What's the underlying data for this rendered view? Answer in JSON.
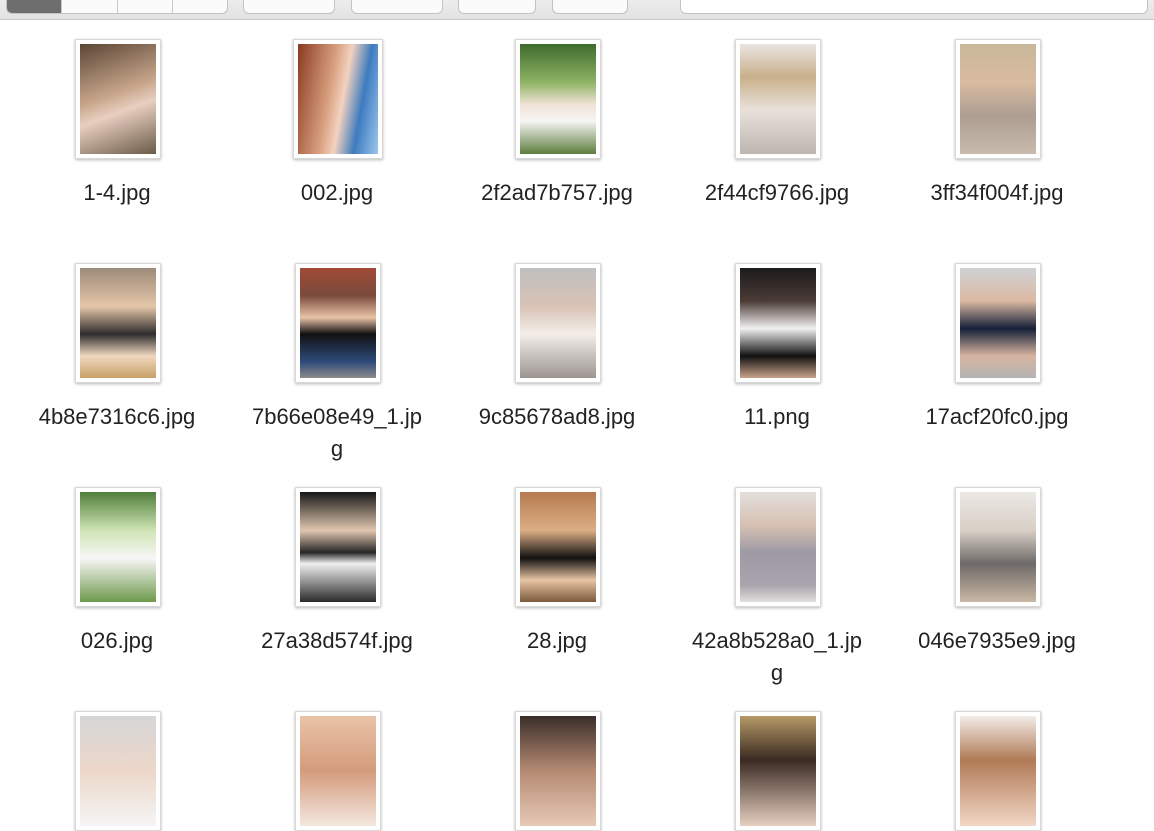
{
  "window": {
    "toolbar": {
      "view_segments": [
        "icon-view",
        "list-view",
        "column-view",
        "gallery-view"
      ],
      "active_segment": "icon-view"
    }
  },
  "files": [
    {
      "name": "1-4.jpg",
      "kind": "image"
    },
    {
      "name": "002.jpg",
      "kind": "image"
    },
    {
      "name": "2f2ad7b757.jpg",
      "kind": "image"
    },
    {
      "name": "2f44cf9766.jpg",
      "kind": "image"
    },
    {
      "name": "3ff34f004f.jpg",
      "kind": "image"
    },
    {
      "name": "4b8e7316c6.jpg",
      "kind": "image"
    },
    {
      "name": "7b66e08e49_1.jpg",
      "kind": "image"
    },
    {
      "name": "9c85678ad8.jpg",
      "kind": "image"
    },
    {
      "name": "11.png",
      "kind": "image"
    },
    {
      "name": "17acf20fc0.jpg",
      "kind": "image"
    },
    {
      "name": "026.jpg",
      "kind": "image"
    },
    {
      "name": "27a38d574f.jpg",
      "kind": "image"
    },
    {
      "name": "28.jpg",
      "kind": "image"
    },
    {
      "name": "42a8b528a0_1.jpg",
      "kind": "image"
    },
    {
      "name": "046e7935e9.jpg",
      "kind": "image"
    },
    {
      "name": "",
      "kind": "image"
    },
    {
      "name": "",
      "kind": "image"
    },
    {
      "name": "",
      "kind": "image"
    },
    {
      "name": "",
      "kind": "image"
    },
    {
      "name": "",
      "kind": "image"
    }
  ],
  "colors": {
    "toolbar_bg": "#e6e6e6",
    "window_bg": "#ffffff",
    "text": "#222222",
    "active_segment": "#6e6e6e"
  }
}
